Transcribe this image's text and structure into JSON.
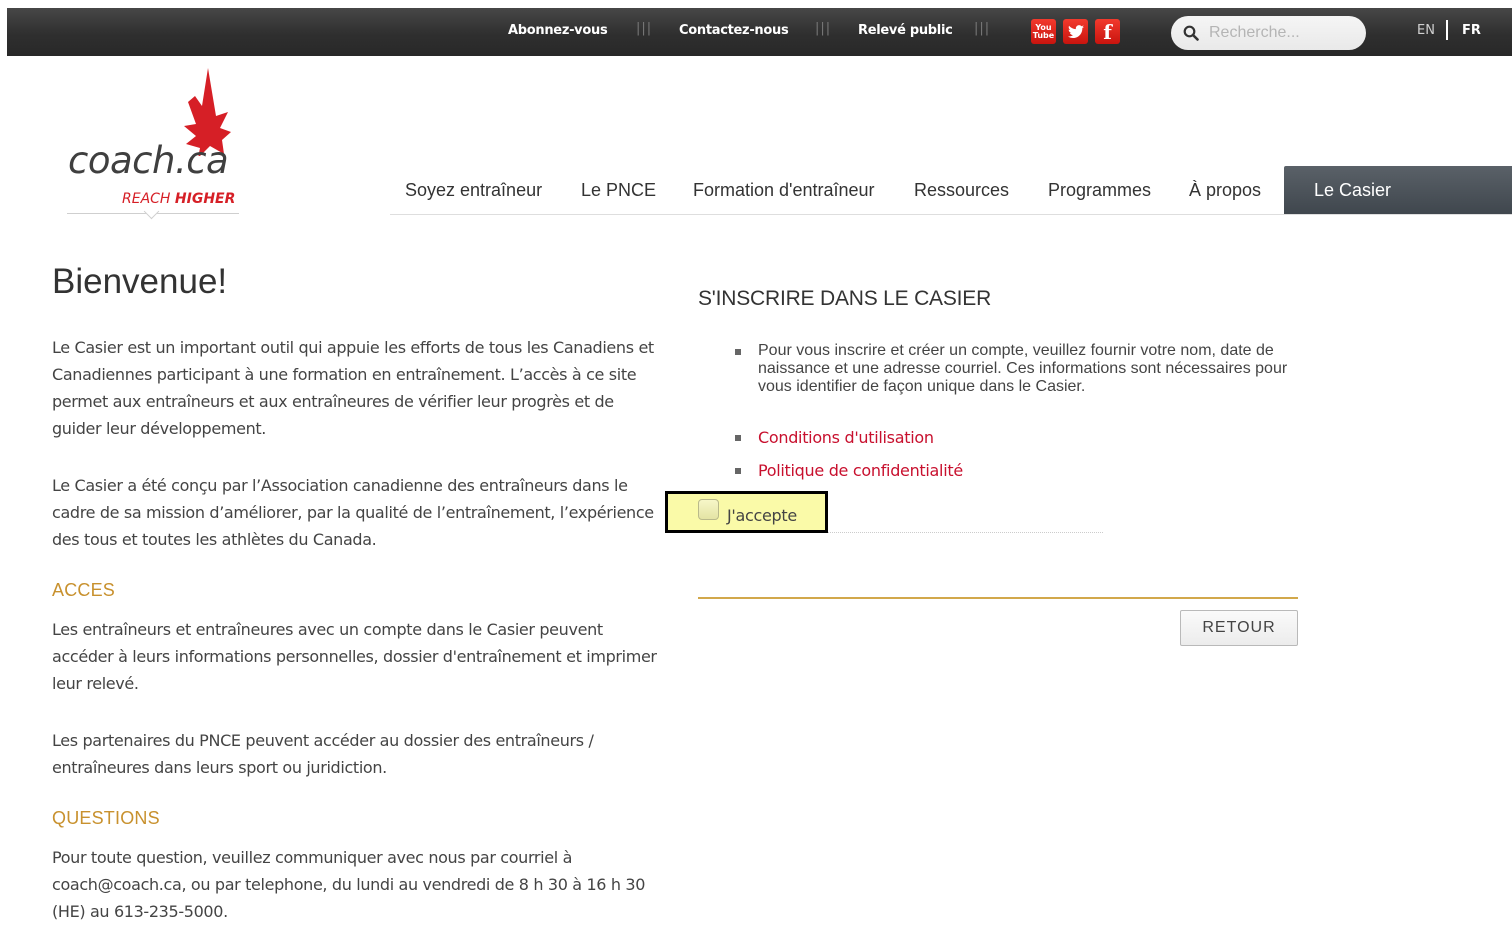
{
  "topbar": {
    "links": [
      "Abonnez-vous",
      "Contactez-nous",
      "Relevé public"
    ],
    "separator": "|||",
    "social": {
      "youtube_top": "You",
      "youtube_bottom": "Tube",
      "facebook": "f"
    },
    "search_placeholder": "Recherche...",
    "lang_en": "EN",
    "lang_fr": "FR"
  },
  "logo": {
    "text": "coach.ca",
    "tagline_light": "REACH ",
    "tagline_bold": "HIGHER"
  },
  "nav": {
    "items": [
      "Soyez entraîneur",
      "Le PNCE",
      "Formation d'entraîneur",
      "Ressources",
      "Programmes",
      "À propos"
    ],
    "active": "Le Casier"
  },
  "main": {
    "title": "Bienvenue!",
    "intro": "Le Casier est un important outil qui appuie les efforts de tous les Canadiens et Canadiennes participant à une formation en entraînement. L’accès à ce site permet aux entraîneurs et aux entraîneures de vérifier leur progrès et de guider leur développement.",
    "design": "Le Casier a été conçu par l’Association canadienne des entraîneurs dans le cadre de sa mission d’améliorer, par la qualité de l’entraînement, l’expérience des tous et toutes les athlètes du Canada.",
    "access_title": "ACCES",
    "access_text": "Les entraîneurs et entraîneures avec un compte dans le Casier peuvent accéder à leurs informations personnelles, dossier d'entraînement et imprimer leur relevé.",
    "partners_text": "Les partenaires du PNCE peuvent accéder au dossier des entraîneurs / entraîneures dans leurs sport ou juridiction.",
    "questions_title": "QUESTIONS",
    "questions_text": "Pour toute question, veuillez communiquer avec nous par courriel à coach@coach.ca, ou par telephone, du lundi au vendredi de 8 h 30 à 16 h 30 (HE) au 613-235-5000."
  },
  "register": {
    "title": "S'INSCRIRE DANS LE CASIER",
    "info": "Pour vous inscrire et créer un compte, veuillez fournir votre nom, date de naissance et une adresse courriel. Ces informations sont nécessaires pour vous identifier de façon unique dans le Casier.",
    "terms_link": "Conditions d'utilisation",
    "privacy_link": "Politique de confidentialité",
    "accept_label": "J'accepte",
    "back_button": "RETOUR"
  },
  "colors": {
    "accent_gold": "#c8912e",
    "link_red": "#c8102e",
    "brand_red": "#d61f26",
    "highlight_yellow": "#fafaa8"
  }
}
